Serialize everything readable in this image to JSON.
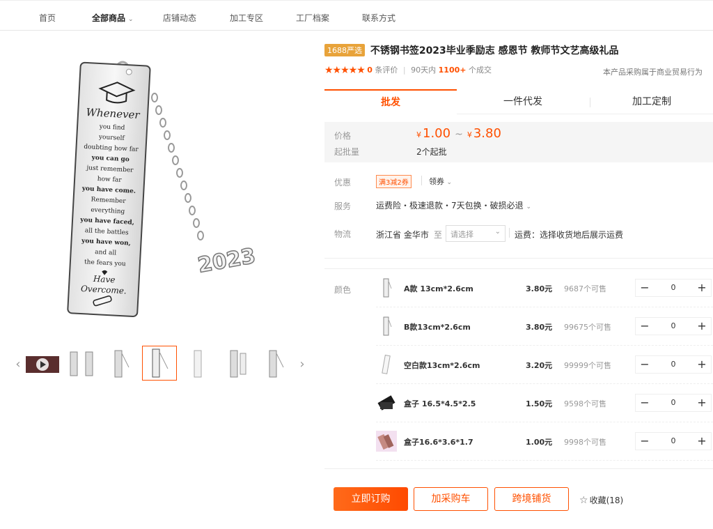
{
  "nav": {
    "items": [
      "首页",
      "全部商品",
      "店铺动态",
      "加工专区",
      "工厂档案",
      "联系方式"
    ]
  },
  "product": {
    "badge": "1688严选",
    "title": "不锈钢书签2023毕业季励志 感恩节 教师节文艺高级礼品",
    "stars": "★★★★★",
    "review_count": "0",
    "review_label": "条评价",
    "days_label": "90天内",
    "sold_count": "1100+",
    "sold_label": "个成交",
    "trade_note": "本产品采购属于商业贸易行为",
    "bookmark_text": [
      "Whenever",
      "you find",
      "yourself",
      "doubting how far",
      "you can go",
      "just remember",
      "how far",
      "you have come.",
      "Remember",
      "everything",
      "you have faced,",
      "all the battles",
      "you have won,",
      "and all",
      "the fears you",
      "Have",
      "Overcome."
    ],
    "charm_text": "2023"
  },
  "tabs": [
    "批发",
    "一件代发",
    "加工定制"
  ],
  "price": {
    "label": "价格",
    "currency": "¥",
    "min": "1.00",
    "tilde": "~",
    "max": "3.80",
    "min_qty_label": "起批量",
    "min_qty": "2个起批"
  },
  "promo": {
    "label": "优惠",
    "coupon": "满3减2券",
    "get_coupon": "领券"
  },
  "service": {
    "label": "服务",
    "text": "运费险・极速退款・7天包换・破损必退"
  },
  "logistics": {
    "label": "物流",
    "from": "浙江省 金华市",
    "to": "至",
    "select_placeholder": "请选择",
    "freight": "运费：选择收货地后展示运费"
  },
  "sku": {
    "label": "颜色",
    "rows": [
      {
        "name": "A款 13cm*2.6cm",
        "price": "3.80元",
        "stock": "9687个可售",
        "qty": "0"
      },
      {
        "name": "B款13cm*2.6cm",
        "price": "3.80元",
        "stock": "99675个可售",
        "qty": "0"
      },
      {
        "name": "空白款13cm*2.6cm",
        "price": "3.20元",
        "stock": "99999个可售",
        "qty": "0"
      },
      {
        "name": "盒子 16.5*4.5*2.5",
        "price": "1.50元",
        "stock": "9598个可售",
        "qty": "0"
      },
      {
        "name": "盒子16.6*3.6*1.7",
        "price": "1.00元",
        "stock": "9998个可售",
        "qty": "0"
      }
    ]
  },
  "actions": {
    "buy_now": "立即订购",
    "add_cart": "加采购车",
    "cross_border": "跨境铺货",
    "favorite": "收藏(18)"
  },
  "colors": {
    "accent": "#ff5000",
    "badge": "#e8a33a"
  }
}
